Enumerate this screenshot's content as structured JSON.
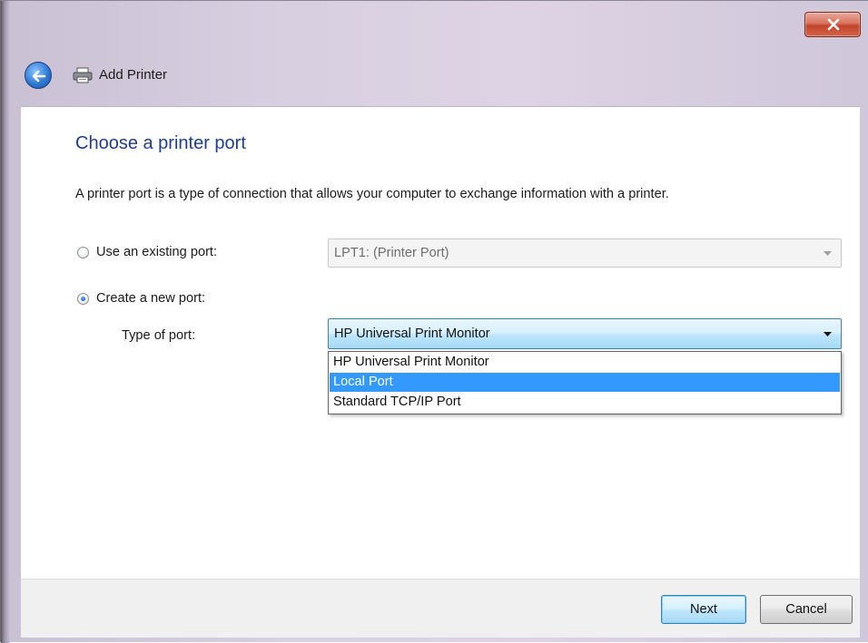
{
  "window": {
    "title": "Add Printer",
    "close_icon": "close-icon",
    "back_icon": "back-arrow-icon",
    "app_icon": "printer-icon"
  },
  "main": {
    "heading": "Choose a printer port",
    "description": "A printer port is a type of connection that allows your computer to exchange information with a printer.",
    "existing_port": {
      "label": "Use an existing port:",
      "selected": false,
      "value": "LPT1: (Printer Port)",
      "enabled": false
    },
    "new_port": {
      "label": "Create a new port:",
      "selected": true,
      "type_label": "Type of port:",
      "value": "HP Universal Print Monitor",
      "dropdown_open": true,
      "options": [
        {
          "label": "HP Universal Print Monitor",
          "highlighted": false
        },
        {
          "label": "Local Port",
          "highlighted": true
        },
        {
          "label": "Standard TCP/IP Port",
          "highlighted": false
        }
      ]
    }
  },
  "footer": {
    "next_label": "Next",
    "cancel_label": "Cancel"
  },
  "colors": {
    "heading": "#1e3d8c",
    "highlight": "#3399ff",
    "close_button": "#c2442b"
  }
}
